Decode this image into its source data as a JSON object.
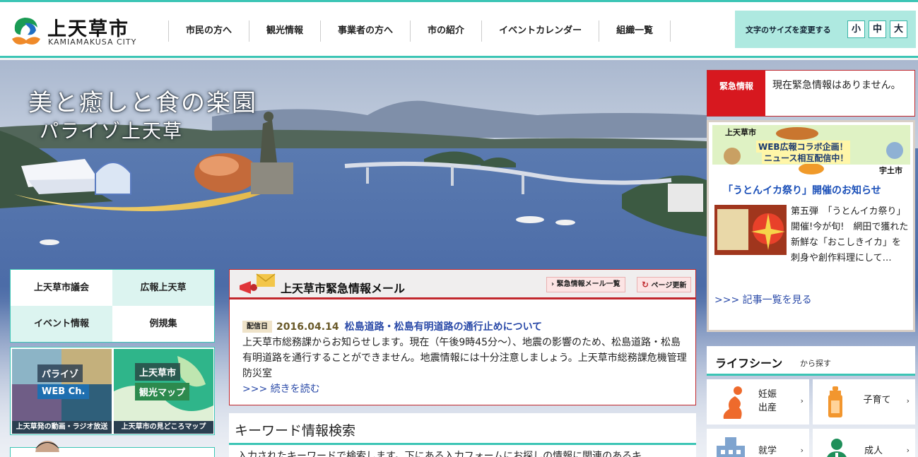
{
  "header": {
    "logo_ja": "上天草市",
    "logo_en": "KAMIAMAKUSA CITY",
    "nav": [
      "市民の方へ",
      "観光情報",
      "事業者の方へ",
      "市の紹介",
      "イベントカレンダー",
      "組織一覧"
    ],
    "fontsize_label": "文字のサイズを変更する",
    "fontsize_small": "小",
    "fontsize_medium": "中",
    "fontsize_large": "大"
  },
  "hero": {
    "catch_line1": "美と癒しと食の楽園",
    "catch_line2": "パライゾ上天草"
  },
  "left": {
    "links": [
      "上天草市議会",
      "広報上天草",
      "イベント情報",
      "例規集"
    ],
    "banner_web_label1": "パライゾ",
    "banner_web_label2": "WEB Ch.",
    "banner_web_caption": "上天草発の動画・ラジオ放送",
    "banner_map_label1": "上天草市",
    "banner_map_label2": "観光マップ",
    "banner_map_caption": "上天草市の見どころマップ"
  },
  "emergency_mail": {
    "title": "上天草市緊急情報メール",
    "list_button": "緊急情報メール一覧",
    "refresh_button": "ページ更新",
    "tag": "配信日",
    "date": "2016.04.14",
    "headline": "松島道路・松島有明道路の通行止めについて",
    "body": "上天草市総務課からお知らせします。現在（午後9時45分～）、地震の影響のため、松島道路・松島有明道路を通行することができません。地震情報には十分注意しましょう。上天草市総務課危機管理防災室",
    "more": ">>> 続きを読む"
  },
  "keyword": {
    "title": "キーワード情報検索",
    "desc": "入力されたキーワードで検索します。下にある入力フォームにお探しの情報に関連のあるキ"
  },
  "alert": {
    "label": "緊急情報",
    "text": "現在緊急情報はありません。"
  },
  "news": {
    "banner_logo": "上天草市",
    "banner_line1": "WEB広報コラボ企画！",
    "banner_line2": "ニュース相互配信中！",
    "banner_partner": "宇土市",
    "title": "「うとんイカ祭り」開催のお知らせ",
    "text": "第五弾　「うとんイカ祭り」開催!今が旬!　網田で獲れた新鮮な「おこしきイカ」を刺身や創作料理にして…",
    "more": ">>> 記事一覧を見る"
  },
  "life": {
    "title": "ライフシーン",
    "suffix": "から探す",
    "items": [
      {
        "line1": "妊娠",
        "line2": "出産"
      },
      {
        "line1": "子育て",
        "line2": ""
      },
      {
        "line1": "就学",
        "line2": ""
      },
      {
        "line1": "成人",
        "line2": ""
      }
    ]
  },
  "colors": {
    "accent": "#3cc5b5",
    "alert_red": "#d7181f",
    "link_blue": "#2a4aa8"
  }
}
